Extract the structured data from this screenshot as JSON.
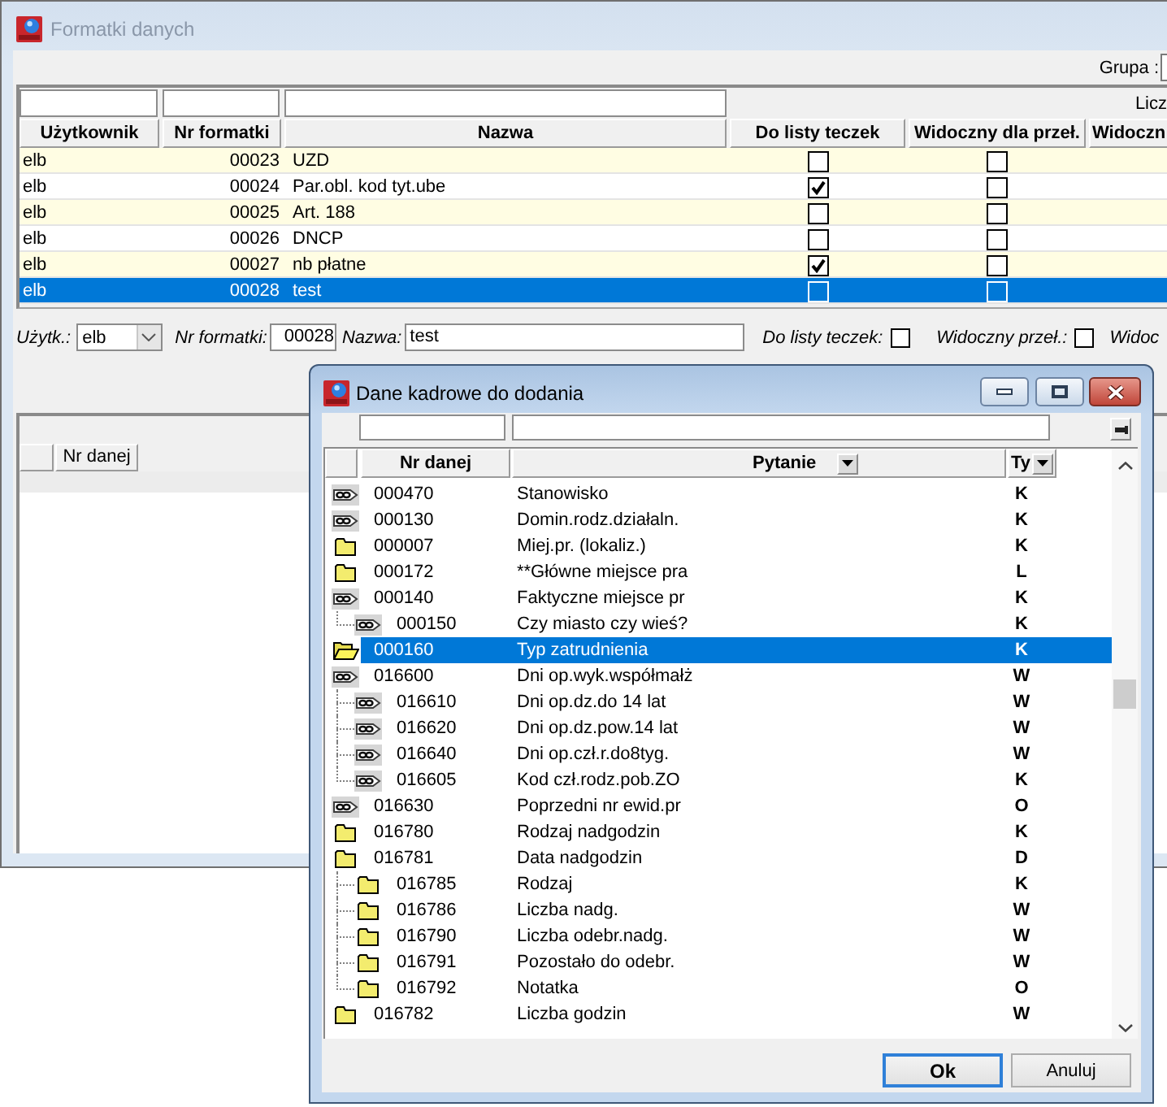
{
  "main_window": {
    "title": "Formatki danych",
    "active": false,
    "group_label": "Grupa :"
  },
  "table": {
    "count_label": "Licz",
    "columns": [
      "Użytkownik",
      "Nr formatki",
      "Nazwa",
      "Do listy teczek",
      "Widoczny dla przeł.",
      "Widoczn"
    ],
    "rows": [
      {
        "user": "elb",
        "number": "00023",
        "name": "UZD",
        "in_folder_list": false,
        "visible_for_switch": false,
        "selected": false
      },
      {
        "user": "elb",
        "number": "00024",
        "name": "Par.obl. kod tyt.ube",
        "in_folder_list": true,
        "visible_for_switch": false,
        "selected": false
      },
      {
        "user": "elb",
        "number": "00025",
        "name": "Art. 188",
        "in_folder_list": false,
        "visible_for_switch": false,
        "selected": false
      },
      {
        "user": "elb",
        "number": "00026",
        "name": "DNCP",
        "in_folder_list": false,
        "visible_for_switch": false,
        "selected": false
      },
      {
        "user": "elb",
        "number": "00027",
        "name": "nb płatne",
        "in_folder_list": true,
        "visible_for_switch": false,
        "selected": false
      },
      {
        "user": "elb",
        "number": "00028",
        "name": "test",
        "in_folder_list": false,
        "visible_for_switch": false,
        "selected": true
      }
    ]
  },
  "form": {
    "user_label": "Użytk.:",
    "user": "elb",
    "number_label": "Nr formatki:",
    "number": "00028",
    "name_label": "Nazwa:",
    "name": "test",
    "folder_list_label": "Do listy teczek:",
    "in_folder_list": false,
    "visible_label": "Widoczny przeł.:",
    "visible_for_switch": false,
    "cut_label": "Widoc"
  },
  "lower_grid": {
    "columns": [
      "Nr danej"
    ]
  },
  "dialog": {
    "title": "Dane kadrowe do dodania",
    "active": true,
    "columns": [
      {
        "label": "Nr danej",
        "dropdown": false
      },
      {
        "label": "Pytanie",
        "dropdown": true
      },
      {
        "label": "Ty",
        "dropdown": true
      }
    ],
    "items": [
      {
        "number": "000470",
        "question": "Stanowisko",
        "type": "K",
        "kind": "link",
        "selected": false
      },
      {
        "number": "000130",
        "question": "Domin.rodz.działaln.",
        "type": "K",
        "kind": "link",
        "selected": false
      },
      {
        "number": "000007",
        "question": "Miej.pr. (lokaliz.)",
        "type": "K",
        "kind": "folder",
        "selected": false
      },
      {
        "number": "000172",
        "question": "**Główne miejsce pra",
        "type": "L",
        "kind": "folder",
        "selected": false
      },
      {
        "number": "000140",
        "question": "Faktyczne miejsce pr",
        "type": "K",
        "kind": "link",
        "selected": false,
        "children": [
          {
            "number": "000150",
            "question": "Czy miasto czy wieś?",
            "type": "K",
            "kind": "link",
            "selected": false
          }
        ]
      },
      {
        "number": "000160",
        "question": "Typ zatrudnienia",
        "type": "K",
        "kind": "open_folder",
        "selected": true
      },
      {
        "number": "016600",
        "question": "Dni op.wyk.współmałż",
        "type": "W",
        "kind": "link",
        "selected": false,
        "children": [
          {
            "number": "016610",
            "question": "Dni op.dz.do 14 lat",
            "type": "W",
            "kind": "link",
            "selected": false
          },
          {
            "number": "016620",
            "question": "Dni op.dz.pow.14 lat",
            "type": "W",
            "kind": "link",
            "selected": false
          },
          {
            "number": "016640",
            "question": "Dni op.czł.r.do8tyg.",
            "type": "W",
            "kind": "link",
            "selected": false
          },
          {
            "number": "016605",
            "question": "Kod czł.rodz.pob.ZO",
            "type": "K",
            "kind": "link",
            "selected": false
          }
        ]
      },
      {
        "number": "016630",
        "question": "Poprzedni nr ewid.pr",
        "type": "O",
        "kind": "link",
        "selected": false
      },
      {
        "number": "016780",
        "question": "Rodzaj nadgodzin",
        "type": "K",
        "kind": "folder",
        "selected": false
      },
      {
        "number": "016781",
        "question": "Data nadgodzin",
        "type": "D",
        "kind": "folder",
        "selected": false,
        "children": [
          {
            "number": "016785",
            "question": "Rodzaj",
            "type": "K",
            "kind": "folder",
            "selected": false
          },
          {
            "number": "016786",
            "question": "Liczba nadg.",
            "type": "W",
            "kind": "folder",
            "selected": false
          },
          {
            "number": "016790",
            "question": "Liczba odebr.nadg.",
            "type": "W",
            "kind": "folder",
            "selected": false
          },
          {
            "number": "016791",
            "question": "Pozostało do odebr.",
            "type": "W",
            "kind": "folder",
            "selected": false
          },
          {
            "number": "016792",
            "question": "Notatka",
            "type": "O",
            "kind": "folder",
            "selected": false
          }
        ]
      },
      {
        "number": "016782",
        "question": "Liczba godzin",
        "type": "W",
        "kind": "folder",
        "selected": false
      }
    ],
    "buttons": [
      {
        "label": "Ok",
        "default": true
      },
      {
        "label": "Anuluj",
        "default": false
      }
    ]
  }
}
